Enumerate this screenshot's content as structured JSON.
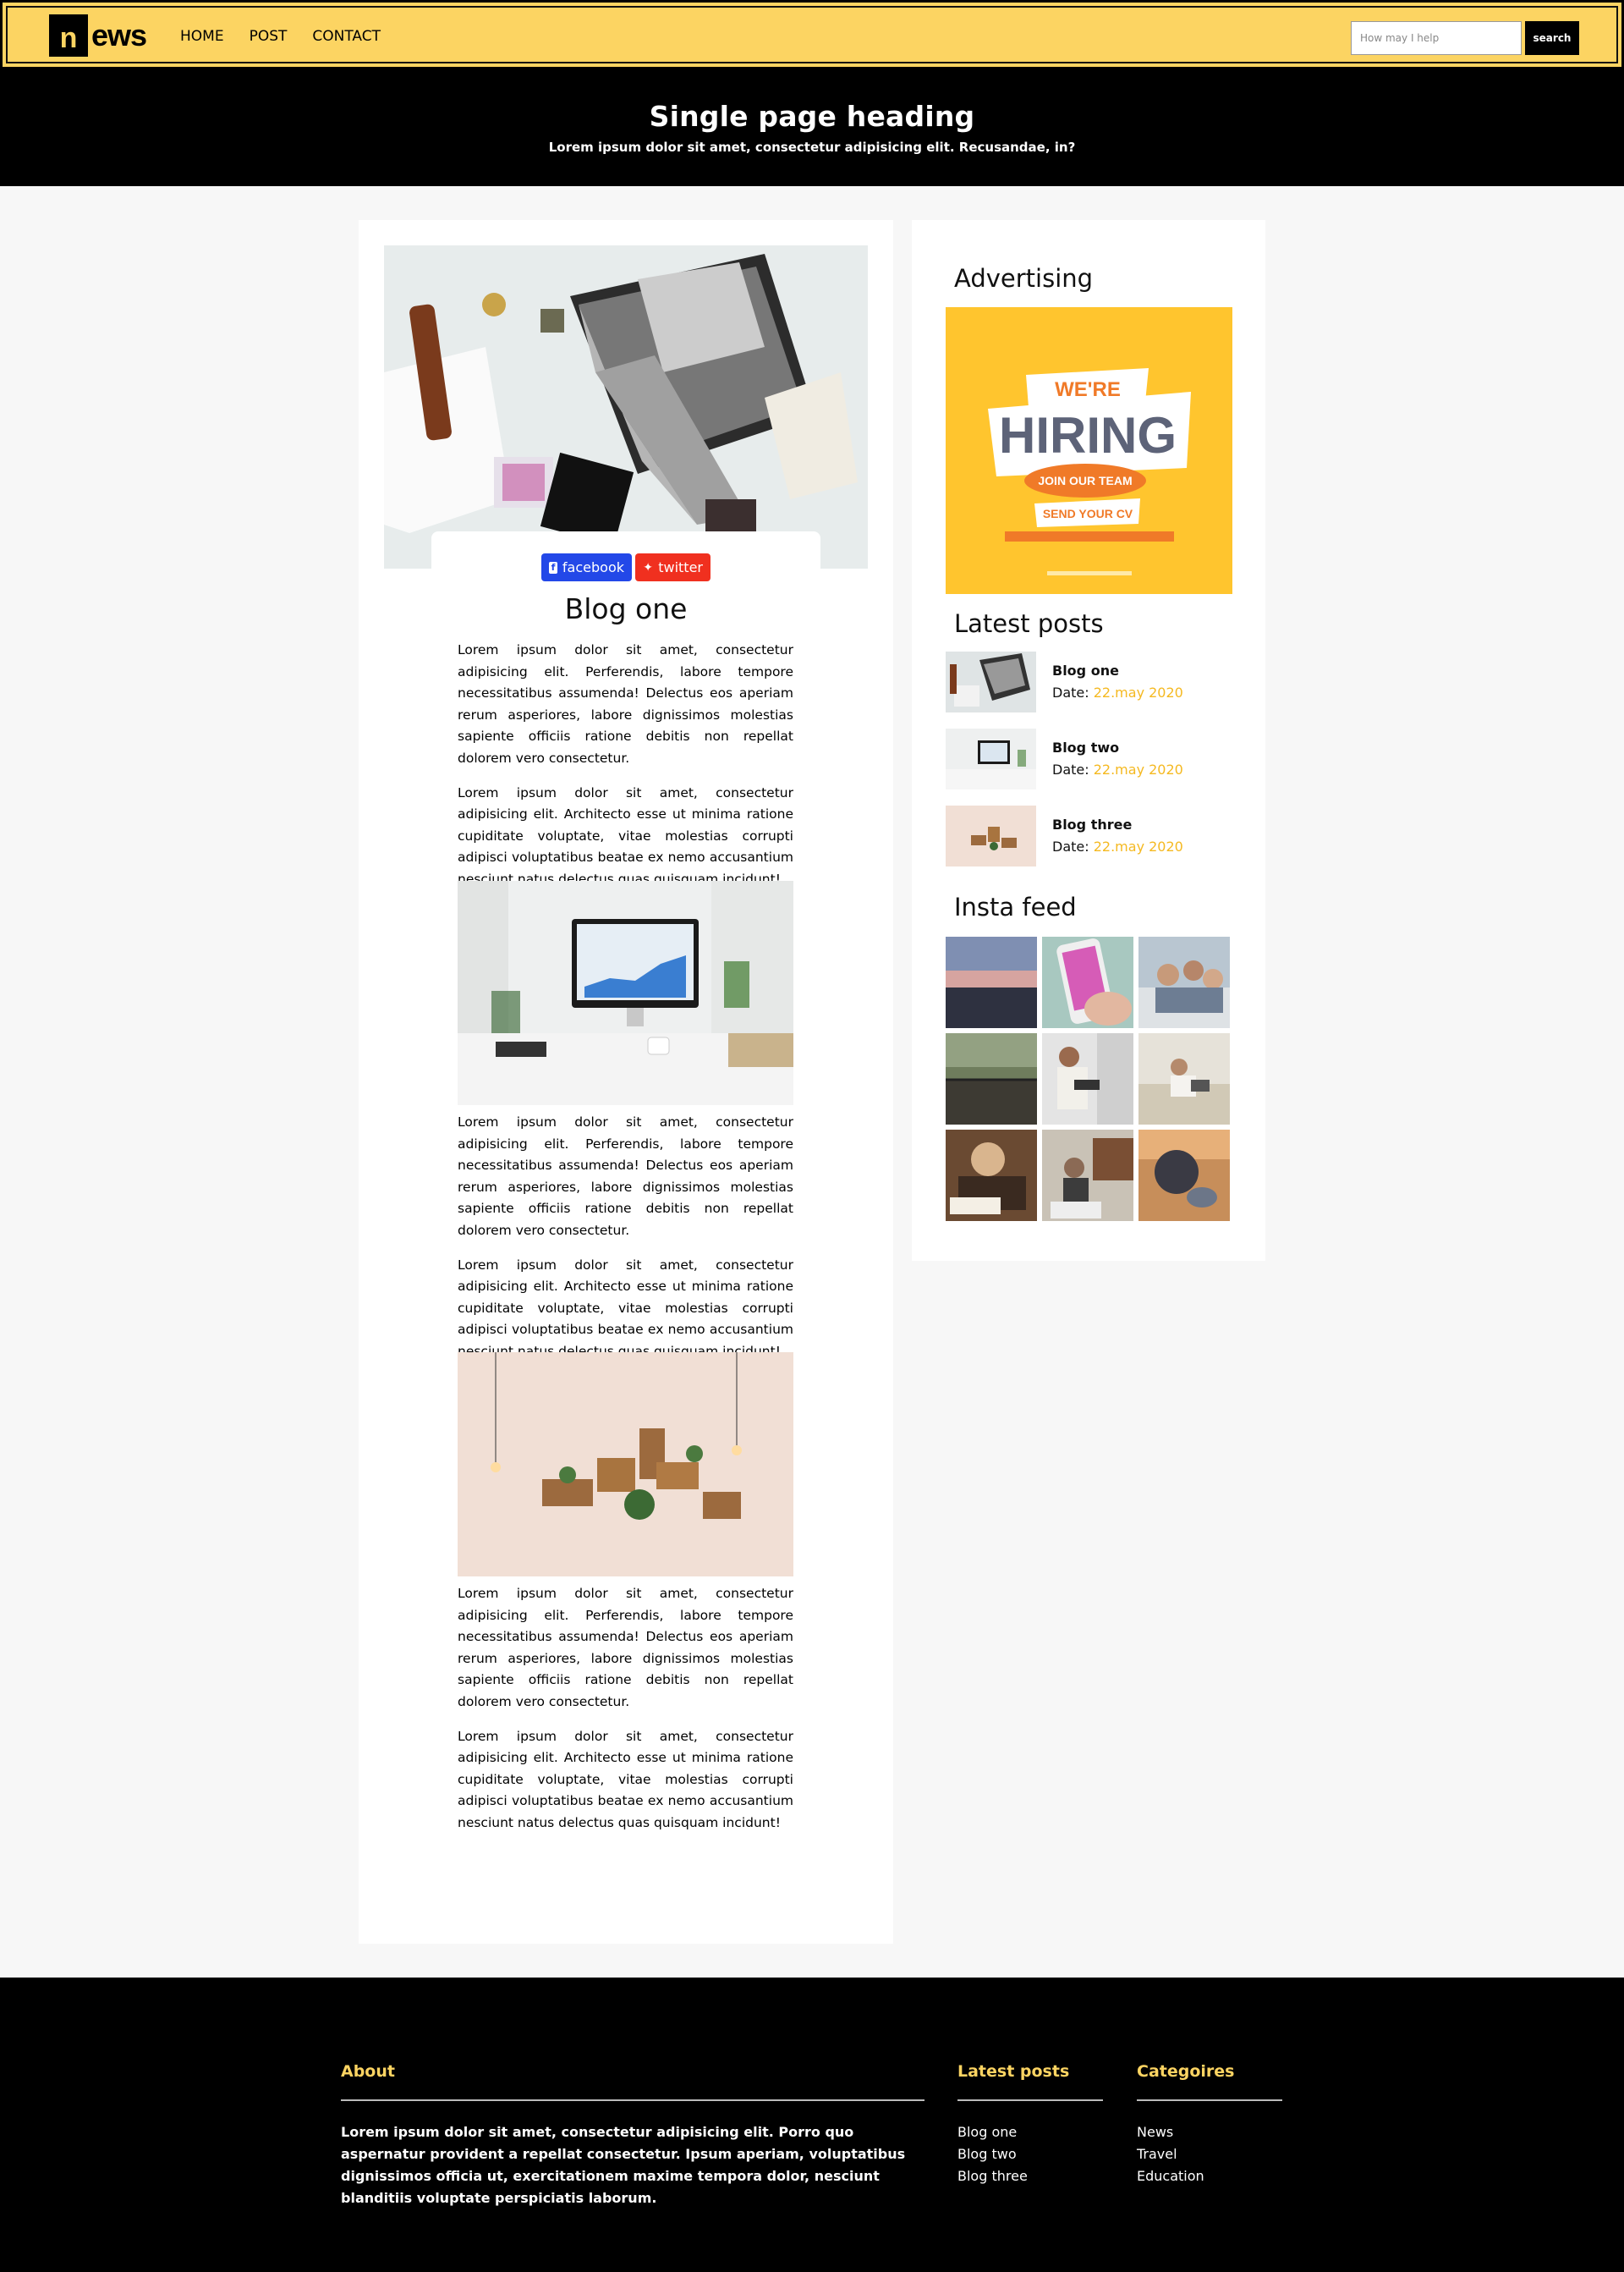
{
  "nav": {
    "logo_letter": "n",
    "logo_rest": "ews",
    "links": [
      "HOME",
      "POST",
      "CONTACT"
    ],
    "search_placeholder": "How may I help",
    "search_button": "search"
  },
  "hero": {
    "title": "Single page heading",
    "subtitle": "Lorem ipsum dolor sit amet, consectetur adipisicing elit. Recusandae, in?"
  },
  "article": {
    "share": {
      "facebook": "facebook",
      "twitter": "twitter"
    },
    "title": "Blog one",
    "paragraphs": [
      "Lorem ipsum dolor sit amet, consectetur adipisicing elit. Perferendis, labore tempore necessitatibus assumenda! Delectus eos aperiam rerum asperiores, labore dignissimos molestias sapiente officiis ratione debitis non repellat dolorem vero consectetur.",
      "Lorem ipsum dolor sit amet, consectetur adipisicing elit. Architecto esse ut minima ratione cupiditate voluptate, vitae molestias corrupti adipisci voluptatibus beatae ex nemo accusantium nesciunt natus delectus quas quisquam incidunt!"
    ]
  },
  "sidebar": {
    "advertising_heading": "Advertising",
    "ad": {
      "line1": "WE'RE",
      "line2": "HIRING",
      "line3": "JOIN OUR TEAM",
      "line4": "SEND YOUR CV"
    },
    "latest_heading": "Latest posts",
    "latest": [
      {
        "title": "Blog one",
        "date_label": "Date:",
        "date": "22.may 2020"
      },
      {
        "title": "Blog two",
        "date_label": "Date:",
        "date": "22.may 2020"
      },
      {
        "title": "Blog three",
        "date_label": "Date:",
        "date": "22.may 2020"
      }
    ],
    "insta_heading": "Insta feed"
  },
  "footer": {
    "about_heading": "About",
    "about_text": "Lorem ipsum dolor sit amet, consectetur adipisicing elit. Porro quo aspernatur provident a repellat consectetur. Ipsum aperiam, voluptatibus dignissimos officia ut, exercitationem maxime tempora dolor, nesciunt blanditiis voluptate perspiciatis laborum.",
    "latest_heading": "Latest posts",
    "latest_links": [
      "Blog one",
      "Blog two",
      "Blog three"
    ],
    "categories_heading": "Categoires",
    "categories": [
      "News",
      "Travel",
      "Education"
    ]
  },
  "colors": {
    "accent_yellow": "#fcd462",
    "date_yellow": "#f5b921",
    "facebook_blue": "#2348e8",
    "twitter_red": "#f0301f"
  }
}
